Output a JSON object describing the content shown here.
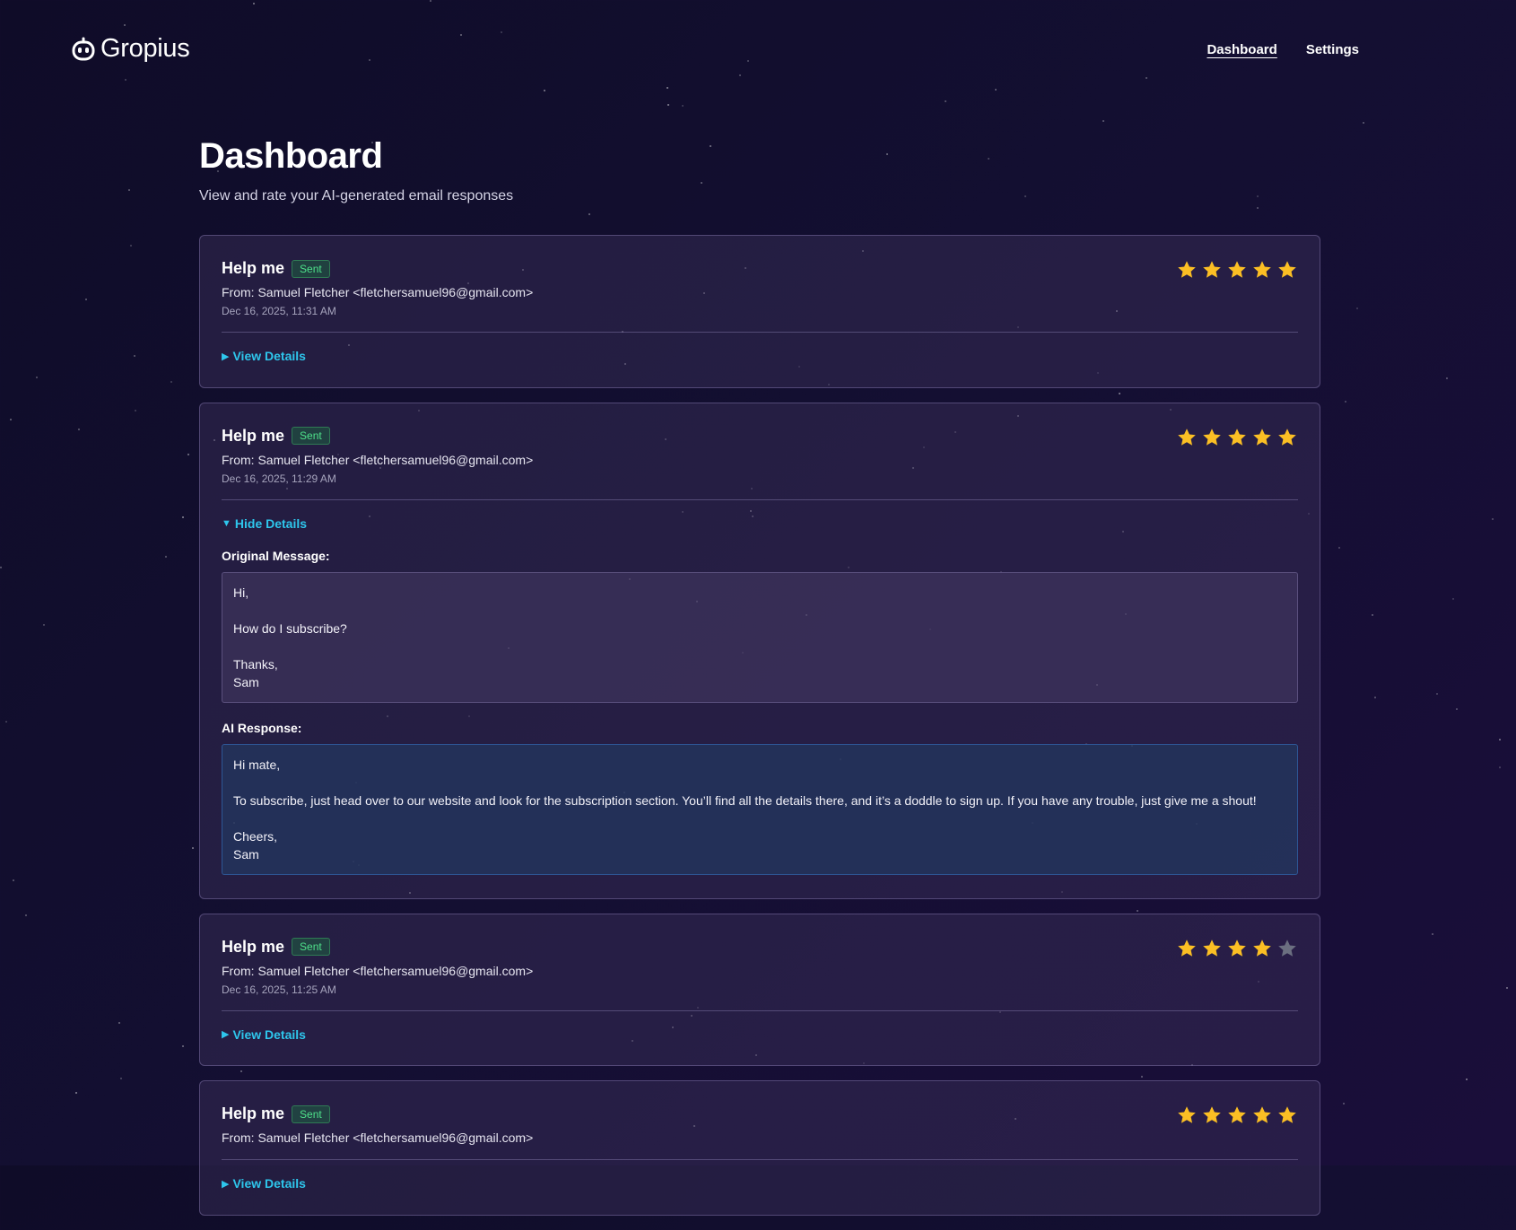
{
  "app": {
    "logo_text": "Gropius"
  },
  "nav": {
    "items": [
      {
        "label": "Dashboard"
      },
      {
        "label": "Settings"
      }
    ]
  },
  "page": {
    "title": "Dashboard",
    "subtitle": "View and rate your AI-generated email responses"
  },
  "labels": {
    "from": "From:",
    "original_message": "Original Message:",
    "ai_response": "AI Response:"
  },
  "colors": {
    "accent_link": "#2ec6ec",
    "star_filled": "#fbbf24",
    "star_empty": "#6b6f80",
    "badge_sent": "#4ee08a"
  },
  "icons": {
    "logo": "robot-icon",
    "star": "star-icon",
    "collapsed": "triangle-right-icon",
    "expanded": "triangle-down-icon"
  },
  "emails": [
    {
      "subject": "Help me",
      "status": "Sent",
      "sender": "Samuel Fletcher <fletchersamuel96@gmail.com>",
      "date": "Dec 16, 2025, 11:31 AM",
      "rating": 5,
      "rating_max": 5,
      "expanded": false,
      "toggle_icon": "▶",
      "toggle_label": "View Details"
    },
    {
      "subject": "Help me",
      "status": "Sent",
      "sender": "Samuel Fletcher <fletchersamuel96@gmail.com>",
      "date": "Dec 16, 2025, 11:29 AM",
      "rating": 5,
      "rating_max": 5,
      "expanded": true,
      "toggle_icon": "▼",
      "toggle_label": "Hide Details",
      "original_message": "Hi,\n\nHow do I subscribe?\n\nThanks,\nSam",
      "ai_response": "Hi mate,\n\nTo subscribe, just head over to our website and look for the subscription section. You’ll find all the details there, and it’s a doddle to sign up. If you have any trouble, just give me a shout!\n\nCheers,\nSam"
    },
    {
      "subject": "Help me",
      "status": "Sent",
      "sender": "Samuel Fletcher <fletchersamuel96@gmail.com>",
      "date": "Dec 16, 2025, 11:25 AM",
      "rating": 4,
      "rating_max": 5,
      "expanded": false,
      "toggle_icon": "▶",
      "toggle_label": "View Details"
    },
    {
      "subject": "Help me",
      "status": "Sent",
      "sender": "Samuel Fletcher <fletchersamuel96@gmail.com>",
      "date": "",
      "rating": 5,
      "rating_max": 5,
      "expanded": false,
      "toggle_icon": "▶",
      "toggle_label": "View Details"
    }
  ]
}
